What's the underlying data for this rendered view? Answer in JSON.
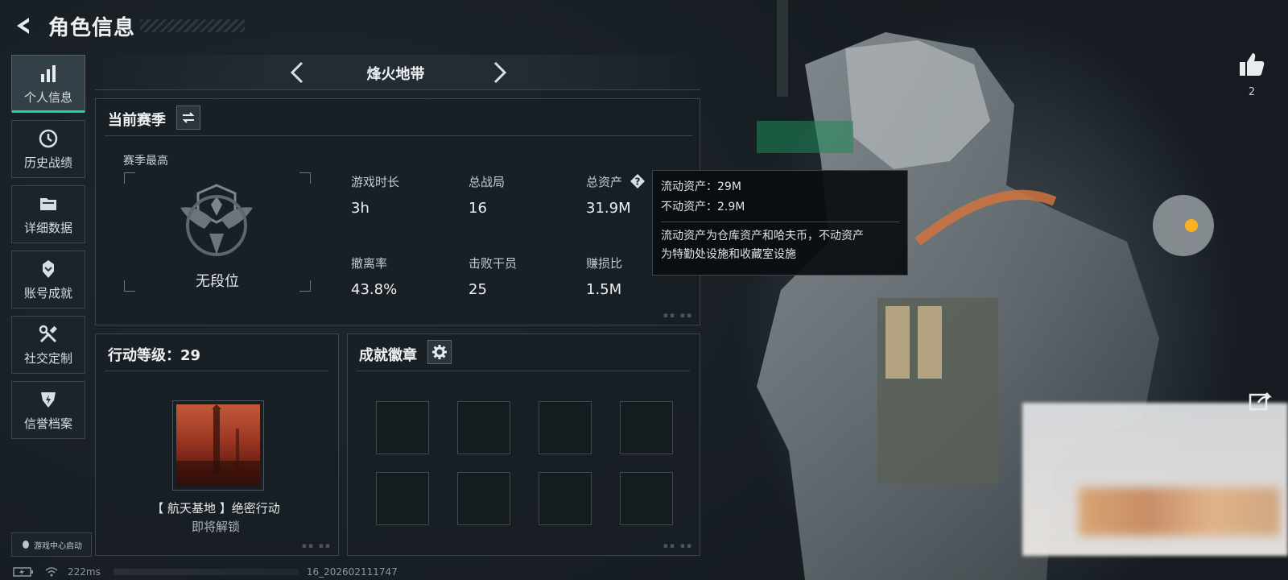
{
  "header": {
    "title": "角色信息"
  },
  "sidebar": {
    "items": [
      {
        "label": "个人信息",
        "icon": "bar-chart-icon"
      },
      {
        "label": "历史战绩",
        "icon": "history-icon"
      },
      {
        "label": "详细数据",
        "icon": "folder-icon"
      },
      {
        "label": "账号成就",
        "icon": "achievement-icon"
      },
      {
        "label": "社交定制",
        "icon": "tools-icon"
      },
      {
        "label": "信誉档案",
        "icon": "reputation-icon"
      }
    ],
    "launch_tag": "游戏中心启动"
  },
  "mode": {
    "title": "烽火地带"
  },
  "season": {
    "title": "当前赛季",
    "best_label": "赛季最高",
    "rank_name": "无段位",
    "stats": [
      {
        "label": "游戏时长",
        "value": "3h"
      },
      {
        "label": "总战局",
        "value": "16"
      },
      {
        "label": "总资产",
        "value": "31.9M"
      },
      {
        "label": "撤离率",
        "value": "43.8%"
      },
      {
        "label": "击败干员",
        "value": "25"
      },
      {
        "label": "赚损比",
        "value": "1.5M"
      }
    ]
  },
  "tooltip": {
    "line1": "流动资产：29M",
    "line2": "不动资产：2.9M",
    "desc1": "流动资产为仓库资产和哈夫币，不动资产",
    "desc2": "为特勤处设施和收藏室设施"
  },
  "action": {
    "title": "行动等级：29",
    "op_name": "【 航天基地 】绝密行动",
    "op_status": "即将解锁"
  },
  "badges": {
    "title": "成就徽章"
  },
  "likes": {
    "count": "2"
  },
  "status": {
    "ping": "222ms",
    "build": "16_202602111747"
  },
  "colors": {
    "accent": "#1fd39a",
    "panel_border": "#39444b",
    "background": "#1a2127"
  }
}
